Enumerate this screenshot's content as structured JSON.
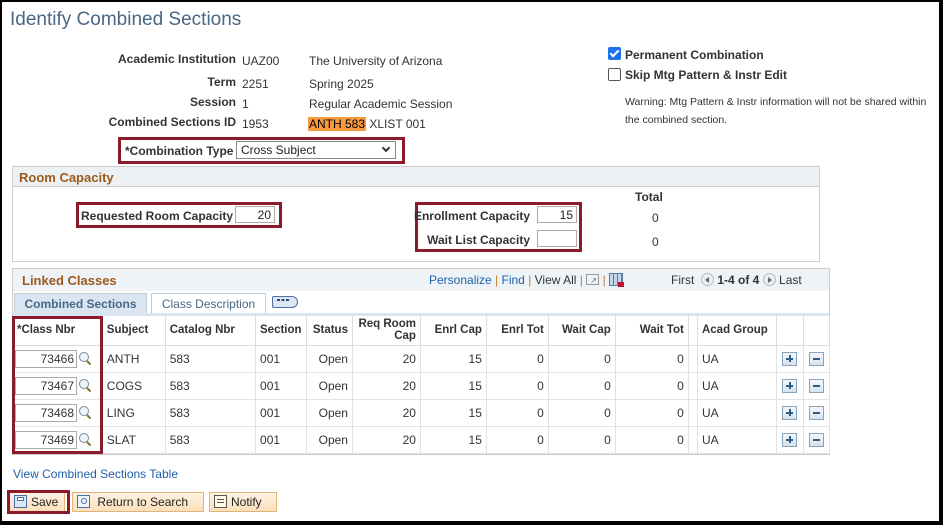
{
  "page": {
    "title": "Identify Combined Sections"
  },
  "header_fields": {
    "academic_institution": {
      "label": "Academic Institution",
      "code": "UAZ00",
      "description": "The University of Arizona"
    },
    "term": {
      "label": "Term",
      "code": "2251",
      "description": "Spring 2025"
    },
    "session": {
      "label": "Session",
      "code": "1",
      "description": "Regular Academic Session"
    },
    "combined_sections_id": {
      "label": "Combined Sections ID",
      "code": "1953",
      "description_highlight": "ANTH 583",
      "description_rest": "XLIST 001"
    },
    "combination_type": {
      "label": "*Combination Type",
      "value": "Cross Subject"
    }
  },
  "options": {
    "permanent_combination": {
      "label": "Permanent Combination",
      "checked": true
    },
    "skip_mtg_pattern": {
      "label": "Skip Mtg Pattern & Instr Edit",
      "checked": false
    },
    "warning_line1": "Warning: Mtg Pattern & Instr information will not be shared within",
    "warning_line2": "the combined section."
  },
  "room_capacity": {
    "title": "Room Capacity",
    "requested_label": "Requested Room Capacity",
    "requested_value": "20",
    "total_header": "Total",
    "enrollment_label": "Enrollment Capacity",
    "enrollment_value": "15",
    "enrollment_total": "0",
    "waitlist_label": "Wait List Capacity",
    "waitlist_value": "",
    "waitlist_total": "0"
  },
  "linked_classes": {
    "title": "Linked Classes",
    "toolbar": {
      "personalize": "Personalize",
      "find": "Find",
      "view_all": "View All",
      "first": "First",
      "range": "1-4 of 4",
      "last": "Last"
    },
    "tabs": [
      {
        "label": "Combined Sections",
        "active": true
      },
      {
        "label": "Class Description",
        "active": false
      }
    ],
    "columns": [
      "*Class Nbr",
      "Subject",
      "Catalog Nbr",
      "Section",
      "Status",
      "Req Room Cap",
      "Enrl Cap",
      "Enrl Tot",
      "Wait Cap",
      "Wait Tot",
      "Acad Group"
    ],
    "rows": [
      {
        "class_nbr": "73466",
        "subject": "ANTH",
        "catalog": "583",
        "section": "001",
        "status": "Open",
        "req_room_cap": "20",
        "enrl_cap": "15",
        "enrl_tot": "0",
        "wait_cap": "0",
        "wait_tot": "0",
        "acad_group": "UA"
      },
      {
        "class_nbr": "73467",
        "subject": "COGS",
        "catalog": "583",
        "section": "001",
        "status": "Open",
        "req_room_cap": "20",
        "enrl_cap": "15",
        "enrl_tot": "0",
        "wait_cap": "0",
        "wait_tot": "0",
        "acad_group": "UA"
      },
      {
        "class_nbr": "73468",
        "subject": "LING",
        "catalog": "583",
        "section": "001",
        "status": "Open",
        "req_room_cap": "20",
        "enrl_cap": "15",
        "enrl_tot": "0",
        "wait_cap": "0",
        "wait_tot": "0",
        "acad_group": "UA"
      },
      {
        "class_nbr": "73469",
        "subject": "SLAT",
        "catalog": "583",
        "section": "001",
        "status": "Open",
        "req_room_cap": "20",
        "enrl_cap": "15",
        "enrl_tot": "0",
        "wait_cap": "0",
        "wait_tot": "0",
        "acad_group": "UA"
      }
    ]
  },
  "footer": {
    "view_table_link": "View Combined Sections Table",
    "save": "Save",
    "return_to_search": "Return to Search",
    "notify": "Notify"
  },
  "colors": {
    "title": "#4a6785",
    "section_header": "#9c5a1c",
    "highlight": "#f79a3e",
    "annotation_box": "#8b1a2b",
    "link": "#1f5fa8"
  }
}
